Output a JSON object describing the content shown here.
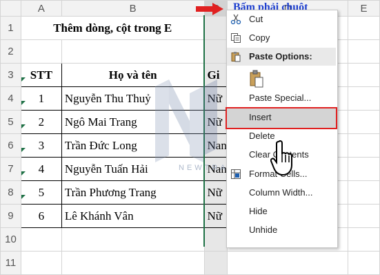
{
  "columns": [
    "A",
    "B",
    "C",
    "D",
    "E"
  ],
  "rows": [
    "1",
    "2",
    "3",
    "4",
    "5",
    "6",
    "7",
    "8",
    "9",
    "10",
    "11"
  ],
  "sheet": {
    "title": "Thêm dòng, cột trong E",
    "headers": {
      "stt": "STT",
      "name": "Họ và tên",
      "gender": "Gi"
    },
    "data": [
      {
        "stt": "1",
        "name": "Nguyễn Thu Thuỷ",
        "gender": "Nữ"
      },
      {
        "stt": "2",
        "name": "Ngô Mai Trang",
        "gender": "Nữ"
      },
      {
        "stt": "3",
        "name": "Trần Đức Long",
        "gender": "Nan"
      },
      {
        "stt": "4",
        "name": "Nguyễn Tuấn Hải",
        "gender": "Nan"
      },
      {
        "stt": "5",
        "name": "Trần Phương Trang",
        "gender": "Nữ"
      },
      {
        "stt": "6",
        "name": "Lê Khánh Vân",
        "gender": "Nữ"
      }
    ]
  },
  "annotation": "Bấm phải chuột",
  "watermark": "NEWTRAIN",
  "context_menu": {
    "cut": "Cut",
    "copy": "Copy",
    "paste_options": "Paste Options:",
    "paste_special": "Paste Special...",
    "insert": "Insert",
    "delete": "Delete",
    "clear_contents": "Clear Contents",
    "format_cells": "Format Cells...",
    "column_width": "Column Width...",
    "hide": "Hide",
    "unhide": "Unhide"
  },
  "colors": {
    "title": "#e00000",
    "annotation": "#1d3fcf",
    "highlight_border": "#e02020",
    "excel_green": "#1e7145"
  }
}
